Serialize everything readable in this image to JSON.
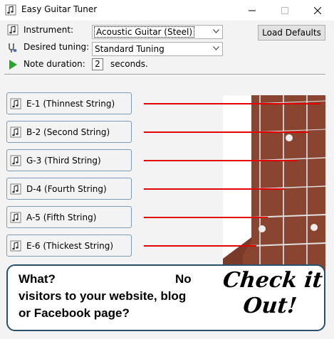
{
  "window": {
    "title": "Easy Guitar Tuner"
  },
  "controls": {
    "instrument_label": "Instrument:",
    "instrument_value": "Acoustic Guitar (Steel)",
    "tuning_label": "Desired tuning:",
    "tuning_value": "Standard Tuning",
    "duration_label": "Note duration:",
    "duration_value": "2",
    "duration_unit": "seconds.",
    "load_defaults_label": "Load Defaults"
  },
  "strings": [
    {
      "label": "E-1 (Thinnest String)"
    },
    {
      "label": "B-2 (Second String)"
    },
    {
      "label": "G-3 (Third String)"
    },
    {
      "label": "D-4 (Fourth String)"
    },
    {
      "label": "A-5 (Fifth String)"
    },
    {
      "label": "E-6 (Thickest String)"
    }
  ],
  "banner": {
    "line1a": "What?",
    "line1b": "No",
    "line2": "visitors to your website, blog",
    "line3": "or Facebook page?",
    "cta_line1": "Check it",
    "cta_line2": "Out!"
  },
  "colors": {
    "accent_line": "#e00000",
    "fretboard": "#7a3a2a",
    "banner_border": "#2a4f6a"
  },
  "icons": {
    "app": "music-note-icon",
    "instrument": "music-note-icon",
    "tuning": "tuning-fork-icon",
    "duration": "play-icon"
  }
}
